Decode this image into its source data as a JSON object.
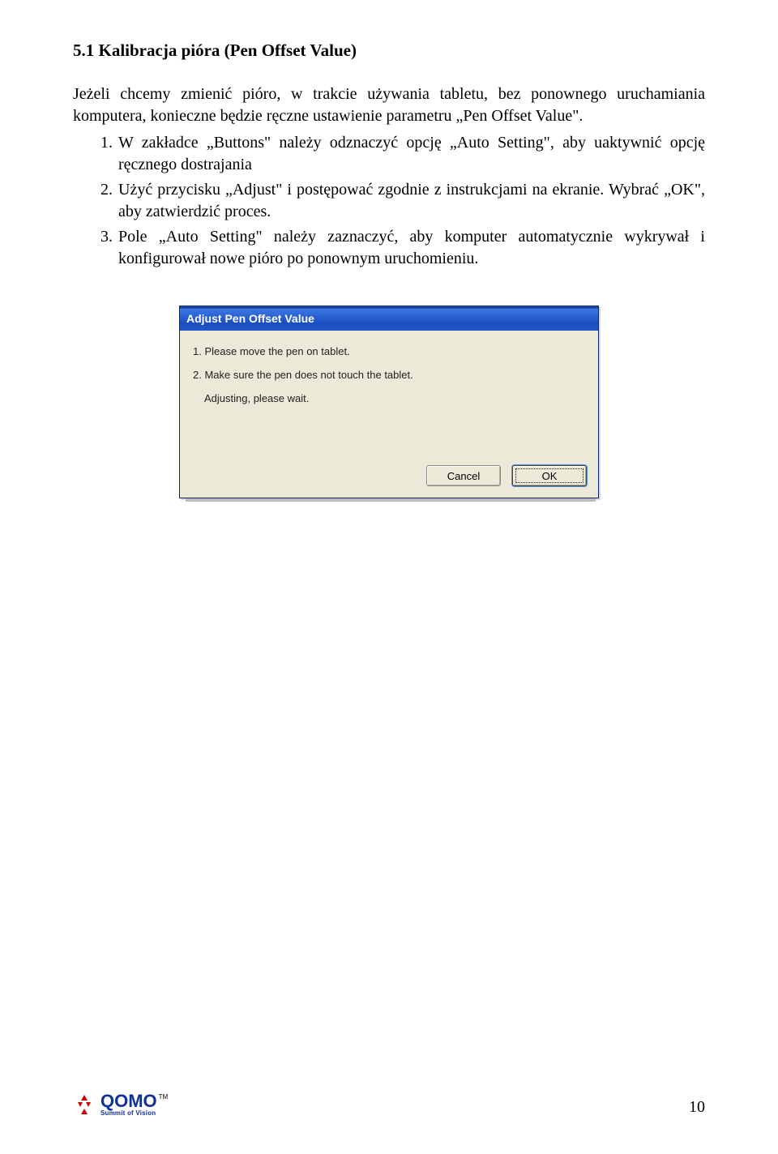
{
  "heading": "5.1 Kalibracja pióra (Pen Offset Value)",
  "paragraph": "Jeżeli chcemy zmienić pióro, w trakcie używania tabletu, bez ponownego uruchamiania komputera, konieczne będzie ręczne ustawienie parametru „Pen Offset Value\".",
  "list": [
    {
      "num": "1.",
      "text": "W zakładce „Buttons\" należy odznaczyć opcję „Auto Setting\", aby uaktywnić opcję ręcznego dostrajania"
    },
    {
      "num": "2.",
      "text": "Użyć przycisku „Adjust\" i postępować zgodnie z instrukcjami na ekranie. Wybrać „OK\", aby zatwierdzić proces."
    },
    {
      "num": "3.",
      "text": "Pole „Auto Setting\" należy zaznaczyć, aby komputer automatycznie wykrywał i konfigurował nowe pióro po ponownym uruchomieniu."
    }
  ],
  "dialog": {
    "title": "Adjust Pen Offset Value",
    "line1": "1. Please move the pen on tablet.",
    "line2": "2. Make sure the pen does not touch the tablet.",
    "line3": "Adjusting, please wait.",
    "cancel": "Cancel",
    "ok": "OK"
  },
  "logo": {
    "text": "QOMO",
    "tm": "TM",
    "tagline": "Summit of Vision"
  },
  "page_num": "10"
}
